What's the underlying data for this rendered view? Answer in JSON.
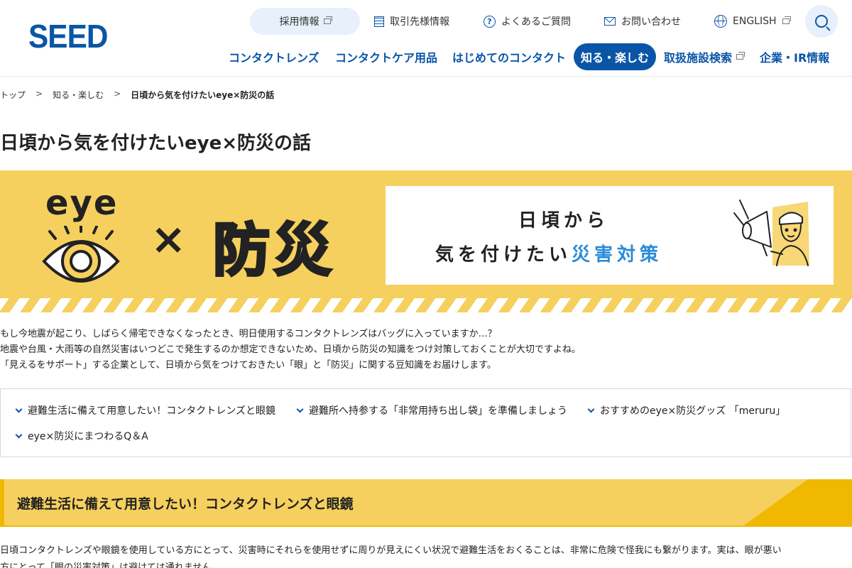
{
  "header": {
    "logo": "SEED",
    "util_links": {
      "recruit": "採用情報",
      "partners": "取引先様情報",
      "faq": "よくあるご質問",
      "contact": "お問い合わせ",
      "english": "ENGLISH"
    },
    "nav": {
      "contact_lens": "コンタクトレンズ",
      "care": "コンタクトケア用品",
      "first": "はじめてのコンタクト",
      "learn": "知る・楽しむ",
      "stores": "取扱施設検索",
      "ir": "企業・IR情報"
    }
  },
  "breadcrumb": {
    "top": "トップ",
    "sep": ">",
    "parent": "知る・楽しむ",
    "current": "日頃から気を付けたいeye×防災の話"
  },
  "page_title": "日頃から気を付けたいeye×防災の話",
  "hero": {
    "eye_word": "eye",
    "times": "×",
    "bousai": "防災",
    "card_line1": "日頃から",
    "card_line2_main": "気を付けたい",
    "card_line2_accent": "災害対策"
  },
  "intro": {
    "p1": "もし今地震が起こり、しばらく帰宅できなくなったとき、明日使用するコンタクトレンズはバッグに入っていますか…？",
    "p2": "地震や台風・大雨等の自然災害はいつどこで発生するのか想定できないため、日頃から防災の知識をつけ対策しておくことが大切ですよね。",
    "p3": "「見えるをサポート」する企業として、日頃から気をつけておきたい「眼」と「防災」に関する豆知識をお届けします。"
  },
  "toc": {
    "item1": "避難生活に備えて用意したい！コンタクトレンズと眼鏡",
    "item2": "避難所へ持参する「非常用持ち出し袋」を準備しましょう",
    "item3": "おすすめのeye×防災グッズ 「meruru」",
    "item4": "eye×防災にまつわるQ＆A"
  },
  "section1": {
    "heading": "避難生活に備えて用意したい！コンタクトレンズと眼鏡",
    "p1": "日頃コンタクトレンズや眼鏡を使用している方にとって、災害時にそれらを使用せずに周りが見えにくい状況で避難生活をおくることは、非常に危険で怪我にも繋がります。実は、眼が悪い",
    "p2": "方にとって「眼の災害対策」は避けては通れません。"
  },
  "colors": {
    "brand_blue": "#0b55a6",
    "hero_yellow": "#f6d05e",
    "accent_yellow": "#f0b800",
    "accent_blue": "#2a8bd8"
  }
}
